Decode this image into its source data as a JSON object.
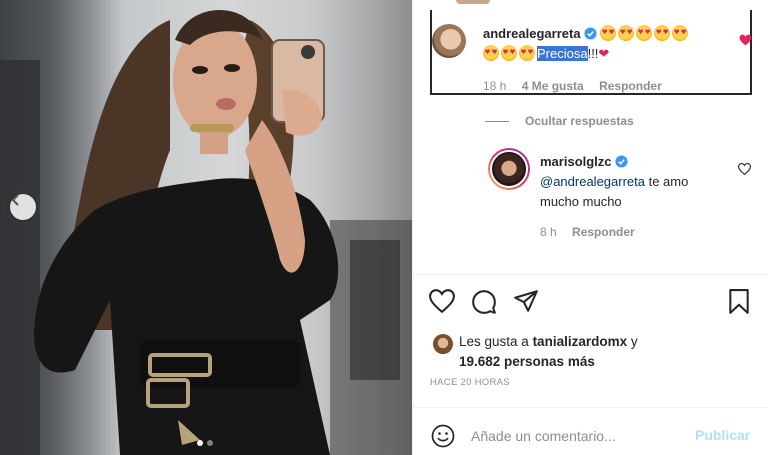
{
  "post": {
    "carousel": {
      "prev_icon": "chevron-left-icon",
      "slide_count": 2,
      "active_slide": 1
    }
  },
  "comments": [
    {
      "username": "andrealegarreta",
      "verified": true,
      "text_selected": "Preciosa",
      "text_after": "!!!",
      "emoji_count": 8,
      "emoji": "heart-eyes-emoji",
      "time": "18 h",
      "likes": "4 Me gusta",
      "reply_label": "Responder",
      "liked": true
    }
  ],
  "hide_replies_label": "Ocultar respuestas",
  "reply": {
    "username": "marisolglzc",
    "verified": true,
    "mention": "@andrealegarreta",
    "text": " te amo mucho mucho",
    "time": "8 h",
    "reply_label": "Responder"
  },
  "likes_summary": {
    "prefix": "Les gusta a ",
    "user": "tanializardomx",
    "middle": " y",
    "count": "19.682 personas más"
  },
  "time_ago": "HACE 20 HORAS",
  "comment_box": {
    "placeholder": "Añade un comentario...",
    "post_label": "Publicar"
  },
  "colors": {
    "selection": "#3b74d9",
    "liked_heart": "#e0245e",
    "verified": "#3897f0",
    "post_disabled": "#b2dffc"
  }
}
